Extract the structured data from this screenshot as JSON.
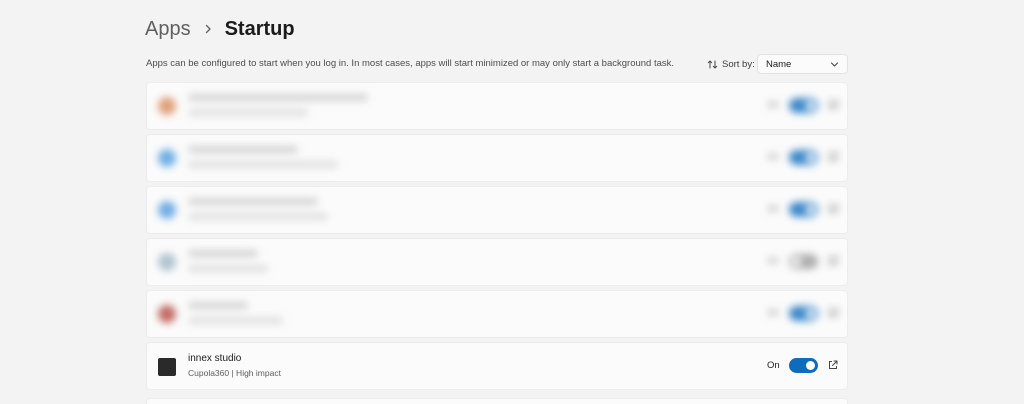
{
  "breadcrumb": {
    "parent": "Apps",
    "current": "Startup"
  },
  "description": "Apps can be configured to start when you log in. In most cases, apps will start minimized or may only start a background task.",
  "sort": {
    "label": "Sort by:",
    "selected": "Name"
  },
  "apps": [
    {
      "name": "",
      "meta": "",
      "state": "",
      "enabled": true,
      "blurred": true,
      "icon_color": "#d98a5a"
    },
    {
      "name": "",
      "meta": "",
      "state": "",
      "enabled": true,
      "blurred": true,
      "icon_color": "#4f9be0"
    },
    {
      "name": "",
      "meta": "",
      "state": "",
      "enabled": true,
      "blurred": true,
      "icon_color": "#4f9be0"
    },
    {
      "name": "",
      "meta": "",
      "state": "",
      "enabled": false,
      "blurred": true,
      "icon_color": "#9fb6c6"
    },
    {
      "name": "",
      "meta": "",
      "state": "",
      "enabled": true,
      "blurred": true,
      "icon_color": "#b5473e"
    },
    {
      "name": "innex studio",
      "meta": "Cupola360  |  High impact",
      "state": "On",
      "enabled": true,
      "blurred": false,
      "icon_color": "#2a2a2a"
    }
  ],
  "colors": {
    "accent": "#0f6cbd",
    "background": "#f3f3f3",
    "card": "#fbfbfb"
  },
  "icons": {
    "breadcrumb_separator": "chevron-right-icon",
    "sort": "sort-arrows-icon",
    "dropdown": "chevron-down-icon",
    "open_external": "open-external-icon"
  }
}
